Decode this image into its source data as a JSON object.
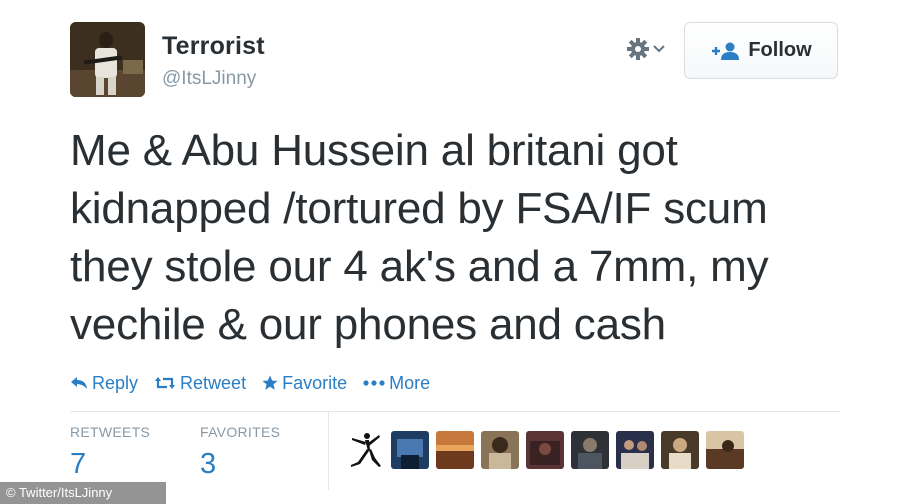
{
  "user": {
    "display_name": "Terrorist",
    "screen_name": "@ItsLJinny"
  },
  "header": {
    "settings_icon": "gear-icon",
    "follow_label": "Follow"
  },
  "tweet": {
    "text": "Me & Abu Hussein al britani got\nkidnapped /tortured by FSA/IF scum\nthey stole our 4 ak's and a 7mm, my\nvechile & our phones and cash"
  },
  "actions": {
    "reply": "Reply",
    "retweet": "Retweet",
    "favorite": "Favorite",
    "more": "More"
  },
  "stats": {
    "retweets_label": "RETWEETS",
    "retweets_value": "7",
    "favorites_label": "FAVORITES",
    "favorites_value": "3"
  },
  "favoriters": [
    {
      "icon": "jumpman-logo-icon"
    },
    {
      "color": "#2b4f7a"
    },
    {
      "color": "#b06a3a"
    },
    {
      "color": "#6b5640"
    },
    {
      "color": "#5a3a3a"
    },
    {
      "color": "#3c3f44"
    },
    {
      "color": "#4a4f6a"
    },
    {
      "color": "#6a5a3a"
    },
    {
      "color": "#7a5a40"
    }
  ],
  "credit": "© Twitter/ItsLJinny",
  "colors": {
    "link": "#2a7ec5",
    "text": "#292f33",
    "muted": "#8899a6",
    "divider": "#e1e8ed"
  }
}
